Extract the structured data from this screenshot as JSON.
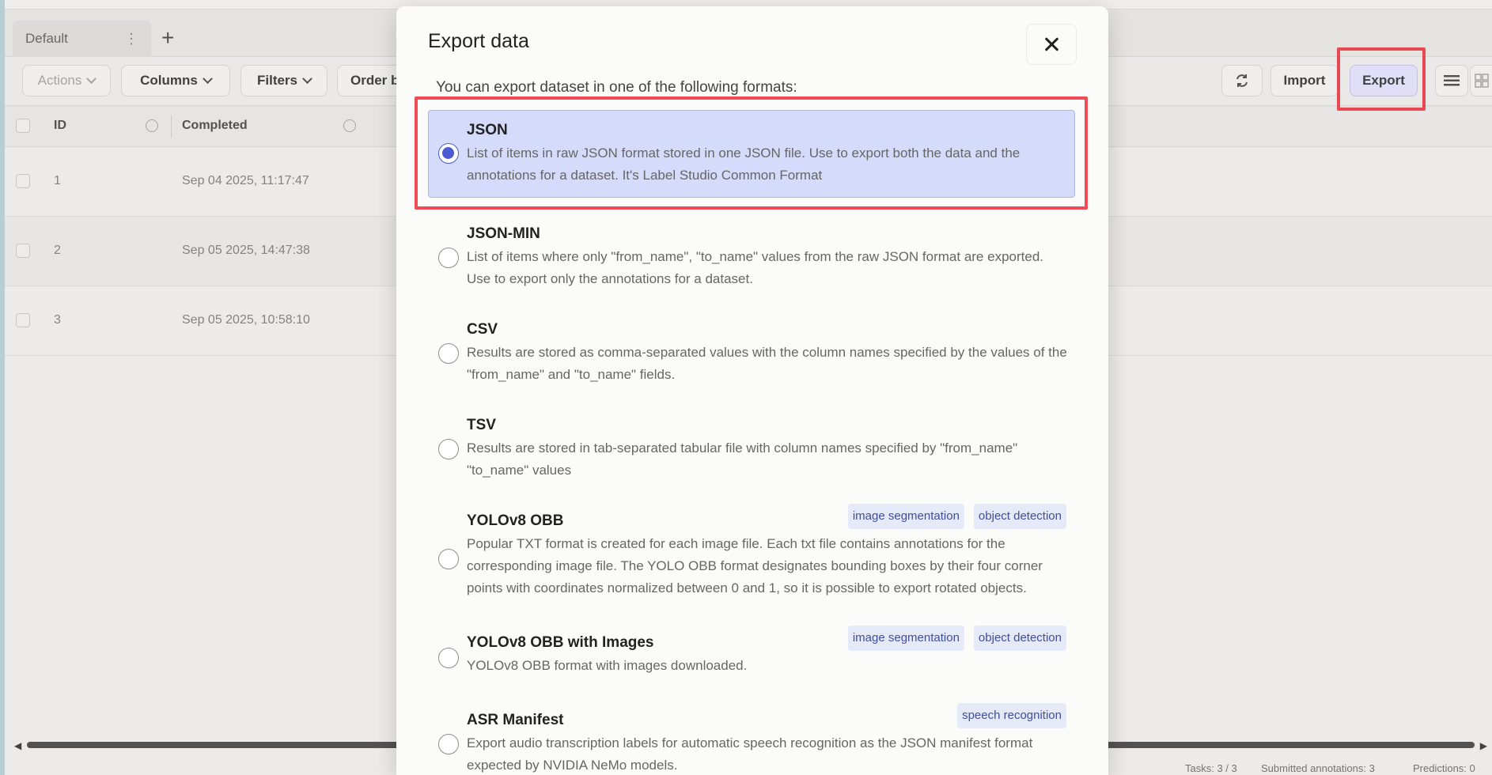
{
  "app": {
    "tab_label": "Default",
    "tab_menu": "⋮",
    "tab_add": "+",
    "toolbar": {
      "actions": "Actions",
      "columns": "Columns",
      "filters": "Filters",
      "order": "Order b",
      "import": "Import",
      "export": "Export"
    },
    "table": {
      "headers": {
        "id": "ID",
        "completed": "Completed"
      },
      "rows": [
        {
          "id": "1",
          "completed": "Sep 04 2025, 11:17:47"
        },
        {
          "id": "2",
          "completed": "Sep 05 2025, 14:47:38"
        },
        {
          "id": "3",
          "completed": "Sep 05 2025, 10:58:10"
        }
      ]
    },
    "footer": {
      "tasks": "Tasks: 3 / 3",
      "submitted": "Submitted annotations: 3",
      "predictions": "Predictions: 0"
    }
  },
  "modal": {
    "title": "Export data",
    "intro": "You can export dataset in one of the following formats:",
    "formats": [
      {
        "title": "JSON",
        "description": "List of items in raw JSON format stored in one JSON file. Use to export both the data and the annotations for a dataset. It's Label Studio Common Format",
        "tags": [],
        "selected": true
      },
      {
        "title": "JSON-MIN",
        "description": "List of items where only \"from_name\", \"to_name\" values from the raw JSON format are exported. Use to export only the annotations for a dataset.",
        "tags": [],
        "selected": false
      },
      {
        "title": "CSV",
        "description": "Results are stored as comma-separated values with the column names specified by the values of the \"from_name\" and \"to_name\" fields.",
        "tags": [],
        "selected": false
      },
      {
        "title": "TSV",
        "description": "Results are stored in tab-separated tabular file with column names specified by \"from_name\" \"to_name\" values",
        "tags": [],
        "selected": false
      },
      {
        "title": "YOLOv8 OBB",
        "description": "Popular TXT format is created for each image file. Each txt file contains annotations for the corresponding image file. The YOLO OBB format designates bounding boxes by their four corner points with coordinates normalized between 0 and 1, so it is possible to export rotated objects.",
        "tags": [
          "image segmentation",
          "object detection"
        ],
        "selected": false
      },
      {
        "title": "YOLOv8 OBB with Images",
        "description": "YOLOv8 OBB format with images downloaded.",
        "tags": [
          "image segmentation",
          "object detection"
        ],
        "selected": false
      },
      {
        "title": "ASR Manifest",
        "description": "Export audio transcription labels for automatic speech recognition as the JSON manifest format expected by NVIDIA NeMo models.",
        "tags": [
          "speech recognition"
        ],
        "selected": false
      }
    ]
  },
  "colors": {
    "highlight": "#ef4b55",
    "selected_bg": "#d5dbfa",
    "radio_accent": "#4a5bd4",
    "tag_bg": "#e6e9f7"
  }
}
